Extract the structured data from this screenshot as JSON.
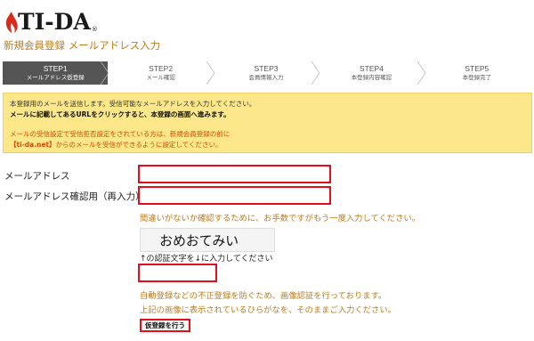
{
  "logo": {
    "text": "TI-DA",
    "reg": "®"
  },
  "page_title": "新規会員登録 メールアドレス入力",
  "steps": [
    {
      "num": "STEP1",
      "label": "メールアドレス仮登録",
      "active": true
    },
    {
      "num": "STEP2",
      "label": "メール確認",
      "active": false
    },
    {
      "num": "STEP3",
      "label": "会員情報入力",
      "active": false
    },
    {
      "num": "STEP4",
      "label": "本登録内容確認",
      "active": false
    },
    {
      "num": "STEP5",
      "label": "本登録完了",
      "active": false
    }
  ],
  "notice": {
    "line1": "本登録用のメールを送信します。受信可能なメールアドレスを入力してください。",
    "line2": "メールに記載してあるURLをクリックすると、本登録の画面へ進みます。",
    "warn1": "メールの受信設定で受信拒否設定をされている方は、新規会員登録の前に",
    "warn2_bold": "【ti-da.net】",
    "warn2_rest": "からのメールを受信ができるように設定してください。"
  },
  "form": {
    "email_label": "メールアドレス",
    "email_value": "",
    "confirm_label": "メールアドレス確認用（再入力）",
    "confirm_value": "",
    "confirm_hint": "間違いがないか確認するために、お手数ですがもう一度入力してください。",
    "captcha_text": "おめおてみい",
    "captcha_caption": "↑の認証文字を↓に入力してください",
    "captcha_value": "",
    "captcha_hint1": "自動登録などの不正登録を防ぐため、画像認証を行っております。",
    "captcha_hint2": "上記の画像に表示されているひらがなを、そのままご入力ください。",
    "submit_label": "仮登録を行う"
  },
  "colors": {
    "accent_orange": "#c07a1a",
    "highlight_red": "#e0101a",
    "notice_bg": "#fce88a",
    "step_active": "#555555"
  }
}
